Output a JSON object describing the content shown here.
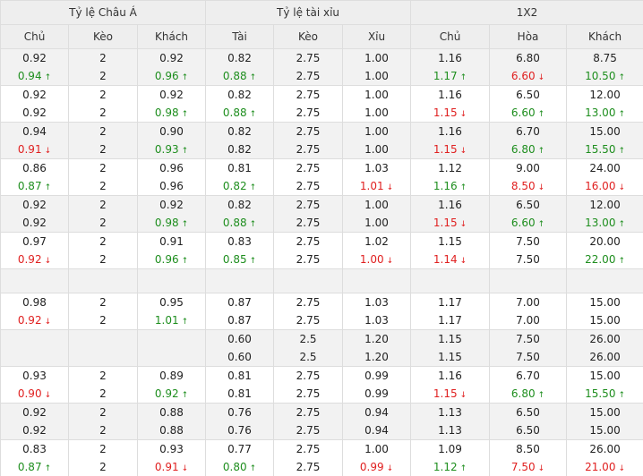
{
  "colors": {
    "up": "#1e8e1e",
    "down": "#e02020"
  },
  "groups": [
    {
      "title": "Tỷ lệ Châu Á",
      "cols": 3
    },
    {
      "title": "Tỷ lệ tài xỉu",
      "cols": 3
    },
    {
      "title": "1X2",
      "cols": 3
    }
  ],
  "columns": [
    "Chủ",
    "Kèo",
    "Khách",
    "Tài",
    "Kèo",
    "Xỉu",
    "Chủ",
    "Hòa",
    "Khách"
  ],
  "rows": [
    [
      [
        [
          "0.92",
          ""
        ],
        [
          "0.94",
          "u"
        ]
      ],
      [
        [
          "2",
          ""
        ],
        [
          "2",
          ""
        ]
      ],
      [
        [
          "0.92",
          ""
        ],
        [
          "0.96",
          "u"
        ]
      ],
      [
        [
          "0.82",
          ""
        ],
        [
          "0.88",
          "u"
        ]
      ],
      [
        [
          "2.75",
          ""
        ],
        [
          "2.75",
          ""
        ]
      ],
      [
        [
          "1.00",
          ""
        ],
        [
          "1.00",
          ""
        ]
      ],
      [
        [
          "1.16",
          ""
        ],
        [
          "1.17",
          "u"
        ]
      ],
      [
        [
          "6.80",
          ""
        ],
        [
          "6.60",
          "d"
        ]
      ],
      [
        [
          "8.75",
          ""
        ],
        [
          "10.50",
          "u"
        ]
      ]
    ],
    [
      [
        [
          "0.92",
          ""
        ],
        [
          "0.92",
          ""
        ]
      ],
      [
        [
          "2",
          ""
        ],
        [
          "2",
          ""
        ]
      ],
      [
        [
          "0.92",
          ""
        ],
        [
          "0.98",
          "u"
        ]
      ],
      [
        [
          "0.82",
          ""
        ],
        [
          "0.88",
          "u"
        ]
      ],
      [
        [
          "2.75",
          ""
        ],
        [
          "2.75",
          ""
        ]
      ],
      [
        [
          "1.00",
          ""
        ],
        [
          "1.00",
          ""
        ]
      ],
      [
        [
          "1.16",
          ""
        ],
        [
          "1.15",
          "d"
        ]
      ],
      [
        [
          "6.50",
          ""
        ],
        [
          "6.60",
          "u"
        ]
      ],
      [
        [
          "12.00",
          ""
        ],
        [
          "13.00",
          "u"
        ]
      ]
    ],
    [
      [
        [
          "0.94",
          ""
        ],
        [
          "0.91",
          "d"
        ]
      ],
      [
        [
          "2",
          ""
        ],
        [
          "2",
          ""
        ]
      ],
      [
        [
          "0.90",
          ""
        ],
        [
          "0.93",
          "u"
        ]
      ],
      [
        [
          "0.82",
          ""
        ],
        [
          "0.82",
          ""
        ]
      ],
      [
        [
          "2.75",
          ""
        ],
        [
          "2.75",
          ""
        ]
      ],
      [
        [
          "1.00",
          ""
        ],
        [
          "1.00",
          ""
        ]
      ],
      [
        [
          "1.16",
          ""
        ],
        [
          "1.15",
          "d"
        ]
      ],
      [
        [
          "6.70",
          ""
        ],
        [
          "6.80",
          "u"
        ]
      ],
      [
        [
          "15.00",
          ""
        ],
        [
          "15.50",
          "u"
        ]
      ]
    ],
    [
      [
        [
          "0.86",
          ""
        ],
        [
          "0.87",
          "u"
        ]
      ],
      [
        [
          "2",
          ""
        ],
        [
          "2",
          ""
        ]
      ],
      [
        [
          "0.96",
          ""
        ],
        [
          "0.96",
          ""
        ]
      ],
      [
        [
          "0.81",
          ""
        ],
        [
          "0.82",
          "u"
        ]
      ],
      [
        [
          "2.75",
          ""
        ],
        [
          "2.75",
          ""
        ]
      ],
      [
        [
          "1.03",
          ""
        ],
        [
          "1.01",
          "d"
        ]
      ],
      [
        [
          "1.12",
          ""
        ],
        [
          "1.16",
          "u"
        ]
      ],
      [
        [
          "9.00",
          ""
        ],
        [
          "8.50",
          "d"
        ]
      ],
      [
        [
          "24.00",
          ""
        ],
        [
          "16.00",
          "d"
        ]
      ]
    ],
    [
      [
        [
          "0.92",
          ""
        ],
        [
          "0.92",
          ""
        ]
      ],
      [
        [
          "2",
          ""
        ],
        [
          "2",
          ""
        ]
      ],
      [
        [
          "0.92",
          ""
        ],
        [
          "0.98",
          "u"
        ]
      ],
      [
        [
          "0.82",
          ""
        ],
        [
          "0.88",
          "u"
        ]
      ],
      [
        [
          "2.75",
          ""
        ],
        [
          "2.75",
          ""
        ]
      ],
      [
        [
          "1.00",
          ""
        ],
        [
          "1.00",
          ""
        ]
      ],
      [
        [
          "1.16",
          ""
        ],
        [
          "1.15",
          "d"
        ]
      ],
      [
        [
          "6.50",
          ""
        ],
        [
          "6.60",
          "u"
        ]
      ],
      [
        [
          "12.00",
          ""
        ],
        [
          "13.00",
          "u"
        ]
      ]
    ],
    [
      [
        [
          "0.97",
          ""
        ],
        [
          "0.92",
          "d"
        ]
      ],
      [
        [
          "2",
          ""
        ],
        [
          "2",
          ""
        ]
      ],
      [
        [
          "0.91",
          ""
        ],
        [
          "0.96",
          "u"
        ]
      ],
      [
        [
          "0.83",
          ""
        ],
        [
          "0.85",
          "u"
        ]
      ],
      [
        [
          "2.75",
          ""
        ],
        [
          "2.75",
          ""
        ]
      ],
      [
        [
          "1.02",
          ""
        ],
        [
          "1.00",
          "d"
        ]
      ],
      [
        [
          "1.15",
          ""
        ],
        [
          "1.14",
          "d"
        ]
      ],
      [
        [
          "7.50",
          ""
        ],
        [
          "7.50",
          ""
        ]
      ],
      [
        [
          "20.00",
          ""
        ],
        [
          "22.00",
          "u"
        ]
      ]
    ],
    [],
    [
      [
        [
          "0.98",
          ""
        ],
        [
          "0.92",
          "d"
        ]
      ],
      [
        [
          "2",
          ""
        ],
        [
          "2",
          ""
        ]
      ],
      [
        [
          "0.95",
          ""
        ],
        [
          "1.01",
          "u"
        ]
      ],
      [
        [
          "0.87",
          ""
        ],
        [
          "0.87",
          ""
        ]
      ],
      [
        [
          "2.75",
          ""
        ],
        [
          "2.75",
          ""
        ]
      ],
      [
        [
          "1.03",
          ""
        ],
        [
          "1.03",
          ""
        ]
      ],
      [
        [
          "1.17",
          ""
        ],
        [
          "1.17",
          ""
        ]
      ],
      [
        [
          "7.00",
          ""
        ],
        [
          "7.00",
          ""
        ]
      ],
      [
        [
          "15.00",
          ""
        ],
        [
          "15.00",
          ""
        ]
      ]
    ],
    [
      [],
      [],
      [],
      [
        [
          "0.60",
          ""
        ],
        [
          "0.60",
          ""
        ]
      ],
      [
        [
          "2.5",
          ""
        ],
        [
          "2.5",
          ""
        ]
      ],
      [
        [
          "1.20",
          ""
        ],
        [
          "1.20",
          ""
        ]
      ],
      [
        [
          "1.15",
          ""
        ],
        [
          "1.15",
          ""
        ]
      ],
      [
        [
          "7.50",
          ""
        ],
        [
          "7.50",
          ""
        ]
      ],
      [
        [
          "26.00",
          ""
        ],
        [
          "26.00",
          ""
        ]
      ]
    ],
    [
      [
        [
          "0.93",
          ""
        ],
        [
          "0.90",
          "d"
        ]
      ],
      [
        [
          "2",
          ""
        ],
        [
          "2",
          ""
        ]
      ],
      [
        [
          "0.89",
          ""
        ],
        [
          "0.92",
          "u"
        ]
      ],
      [
        [
          "0.81",
          ""
        ],
        [
          "0.81",
          ""
        ]
      ],
      [
        [
          "2.75",
          ""
        ],
        [
          "2.75",
          ""
        ]
      ],
      [
        [
          "0.99",
          ""
        ],
        [
          "0.99",
          ""
        ]
      ],
      [
        [
          "1.16",
          ""
        ],
        [
          "1.15",
          "d"
        ]
      ],
      [
        [
          "6.70",
          ""
        ],
        [
          "6.80",
          "u"
        ]
      ],
      [
        [
          "15.00",
          ""
        ],
        [
          "15.50",
          "u"
        ]
      ]
    ],
    [
      [
        [
          "0.92",
          ""
        ],
        [
          "0.92",
          ""
        ]
      ],
      [
        [
          "2",
          ""
        ],
        [
          "2",
          ""
        ]
      ],
      [
        [
          "0.88",
          ""
        ],
        [
          "0.88",
          ""
        ]
      ],
      [
        [
          "0.76",
          ""
        ],
        [
          "0.76",
          ""
        ]
      ],
      [
        [
          "2.75",
          ""
        ],
        [
          "2.75",
          ""
        ]
      ],
      [
        [
          "0.94",
          ""
        ],
        [
          "0.94",
          ""
        ]
      ],
      [
        [
          "1.13",
          ""
        ],
        [
          "1.13",
          ""
        ]
      ],
      [
        [
          "6.50",
          ""
        ],
        [
          "6.50",
          ""
        ]
      ],
      [
        [
          "15.00",
          ""
        ],
        [
          "15.00",
          ""
        ]
      ]
    ],
    [
      [
        [
          "0.83",
          ""
        ],
        [
          "0.87",
          "u"
        ]
      ],
      [
        [
          "2",
          ""
        ],
        [
          "2",
          ""
        ]
      ],
      [
        [
          "0.93",
          ""
        ],
        [
          "0.91",
          "d"
        ]
      ],
      [
        [
          "0.77",
          ""
        ],
        [
          "0.80",
          "u"
        ]
      ],
      [
        [
          "2.75",
          ""
        ],
        [
          "2.75",
          ""
        ]
      ],
      [
        [
          "1.00",
          ""
        ],
        [
          "0.99",
          "d"
        ]
      ],
      [
        [
          "1.09",
          ""
        ],
        [
          "1.12",
          "u"
        ]
      ],
      [
        [
          "8.50",
          ""
        ],
        [
          "7.50",
          "d"
        ]
      ],
      [
        [
          "26.00",
          ""
        ],
        [
          "21.00",
          "d"
        ]
      ]
    ]
  ]
}
